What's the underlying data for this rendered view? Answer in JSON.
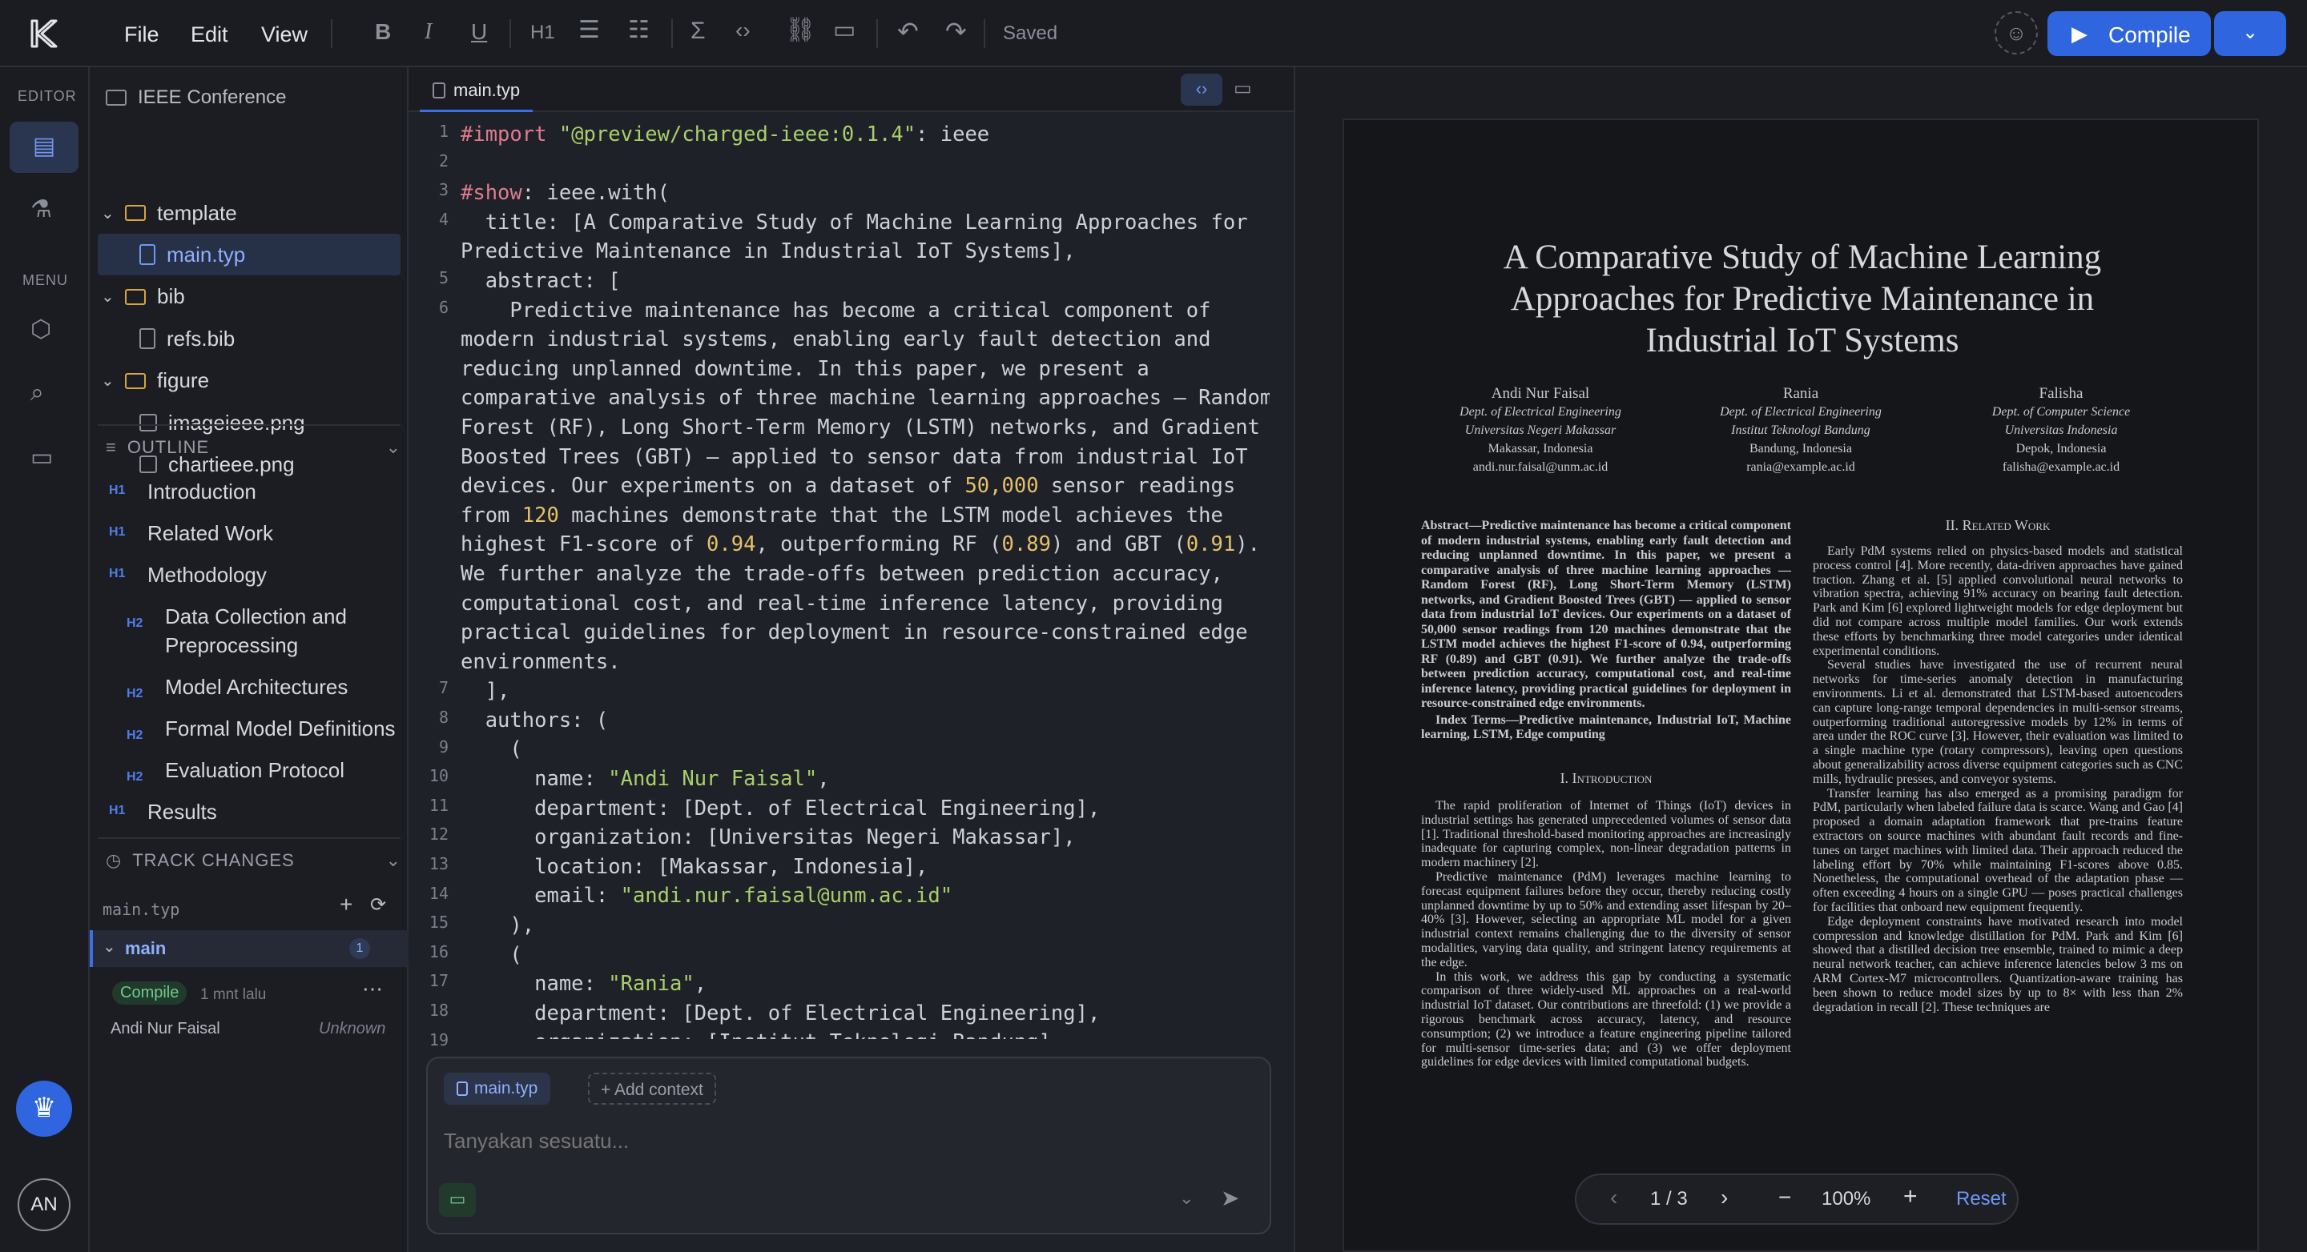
{
  "menu": {
    "file": "File",
    "edit": "Edit",
    "view": "View"
  },
  "toolbar": {
    "h1": "H1",
    "saved": "Saved",
    "compile": "Compile"
  },
  "rail": {
    "editor": "EDITOR",
    "menu": "MENU",
    "avatar": "AN"
  },
  "project": {
    "name": "IEEE Conference",
    "items": [
      {
        "label": "template",
        "kind": "folder"
      },
      {
        "label": "main.typ",
        "kind": "file"
      },
      {
        "label": "bib",
        "kind": "folder"
      },
      {
        "label": "refs.bib",
        "kind": "file"
      },
      {
        "label": "figure",
        "kind": "folder"
      },
      {
        "label": "imageieee.png",
        "kind": "image"
      },
      {
        "label": "chartieee.png",
        "kind": "image"
      }
    ]
  },
  "outline": {
    "title": "OUTLINE",
    "items": [
      {
        "tag": "H1",
        "label": "Introduction"
      },
      {
        "tag": "H1",
        "label": "Related Work"
      },
      {
        "tag": "H1",
        "label": "Methodology"
      },
      {
        "tag": "H2",
        "label": "Data Collection and Preprocessing"
      },
      {
        "tag": "H2",
        "label": "Model Architectures"
      },
      {
        "tag": "H2",
        "label": "Formal Model Definitions"
      },
      {
        "tag": "H2",
        "label": "Evaluation Protocol"
      },
      {
        "tag": "H1",
        "label": "Results"
      }
    ]
  },
  "track": {
    "title": "TRACK CHANGES",
    "file": "main.typ",
    "branch": "main",
    "count": "1",
    "badge": "Compile",
    "time": "1 mnt lalu",
    "author": "Andi Nur Faisal",
    "status": "Unknown"
  },
  "editor": {
    "tab": "main.typ"
  },
  "chat": {
    "file": "main.typ",
    "add": "+ Add context",
    "placeholder": "Tanyakan sesuatu..."
  },
  "pdf": {
    "title": "A Comparative Study of Machine Learning Approaches for Predictive Maintenance in Industrial IoT Systems",
    "authors": [
      {
        "name": "Andi Nur Faisal",
        "dept": "Dept. of Electrical Engineering",
        "org": "Universitas Negeri Makassar",
        "loc": "Makassar, Indonesia",
        "email": "andi.nur.faisal@unm.ac.id"
      },
      {
        "name": "Rania",
        "dept": "Dept. of Electrical Engineering",
        "org": "Institut Teknologi Bandung",
        "loc": "Bandung, Indonesia",
        "email": "rania@example.ac.id"
      },
      {
        "name": "Falisha",
        "dept": "Dept. of Computer Science",
        "org": "Universitas Indonesia",
        "loc": "Depok, Indonesia",
        "email": "falisha@example.ac.id"
      }
    ],
    "abstract": "Abstract—Predictive maintenance has become a critical component of modern industrial systems, enabling early fault detection and reducing unplanned downtime. In this paper, we present a comparative analysis of three machine learning approaches — Random Forest (RF), Long Short-Term Memory (LSTM) networks, and Gradient Boosted Trees (GBT) — applied to sensor data from industrial IoT devices. Our experiments on a dataset of 50,000 sensor readings from 120 machines demonstrate that the LSTM model achieves the highest F1-score of 0.94, outperforming RF (0.89) and GBT (0.91). We further analyze the trade-offs between prediction accuracy, computational cost, and real-time inference latency, providing practical guidelines for deployment in resource-constrained edge environments.",
    "index": "Index Terms—Predictive maintenance, Industrial IoT, Machine learning, LSTM, Edge computing",
    "sec1": "I. Introduction",
    "intro1": "The rapid proliferation of Internet of Things (IoT) devices in industrial settings has generated unprecedented volumes of sensor data [1]. Traditional threshold-based monitoring approaches are increasingly inadequate for capturing complex, non-linear degradation patterns in modern machinery [2].",
    "intro2": "Predictive maintenance (PdM) leverages machine learning to forecast equipment failures before they occur, thereby reducing costly unplanned downtime by up to 50% and extending asset lifespan by 20–40% [3]. However, selecting an appropriate ML model for a given industrial context remains challenging due to the diversity of sensor modalities, varying data quality, and stringent latency requirements at the edge.",
    "intro3": "In this work, we address this gap by conducting a systematic comparison of three widely-used ML approaches on a real-world industrial IoT dataset. Our contributions are threefold: (1) we provide a rigorous benchmark across accuracy, latency, and resource consumption; (2) we introduce a feature engineering pipeline tailored for multi-sensor time-series data; and (3) we offer deployment guidelines for edge devices with limited computational budgets.",
    "sec2": "II. Related Work",
    "rw1": "Early PdM systems relied on physics-based models and statistical process control [4]. More recently, data-driven approaches have gained traction. Zhang et al. [5] applied convolutional neural networks to vibration spectra, achieving 91% accuracy on bearing fault detection. Park and Kim [6] explored lightweight models for edge deployment but did not compare across multiple model families. Our work extends these efforts by benchmarking three model categories under identical experimental conditions.",
    "rw2": "Several studies have investigated the use of recurrent neural networks for time-series anomaly detection in manufacturing environments. Li et al. demonstrated that LSTM-based autoencoders can capture long-range temporal dependencies in multi-sensor streams, outperforming traditional autoregressive models by 12% in terms of area under the ROC curve [3]. However, their evaluation was limited to a single machine type (rotary compressors), leaving open questions about generalizability across diverse equipment categories such as CNC mills, hydraulic presses, and conveyor systems.",
    "rw3": "Transfer learning has also emerged as a promising paradigm for PdM, particularly when labeled failure data is scarce. Wang and Gao [4] proposed a domain adaptation framework that pre-trains feature extractors on source machines with abundant fault records and fine-tunes on target machines with limited data. Their approach reduced the labeling effort by 70% while maintaining F1-scores above 0.85. Nonetheless, the computational overhead of the adaptation phase — often exceeding 4 hours on a single GPU — poses practical challenges for facilities that onboard new equipment frequently.",
    "rw4": "Edge deployment constraints have motivated research into model compression and knowledge distillation for PdM. Park and Kim [6] showed that a distilled decision tree ensemble, trained to mimic a deep neural network teacher, can achieve inference latencies below 3 ms on ARM Cortex-M7 microcontrollers. Quantization-aware training has been shown to reduce model sizes by up to 8× with less than 2% degradation in recall [2]. These techniques are"
  },
  "pager": {
    "page": "1 / 3",
    "zoom": "100%",
    "reset": "Reset"
  }
}
